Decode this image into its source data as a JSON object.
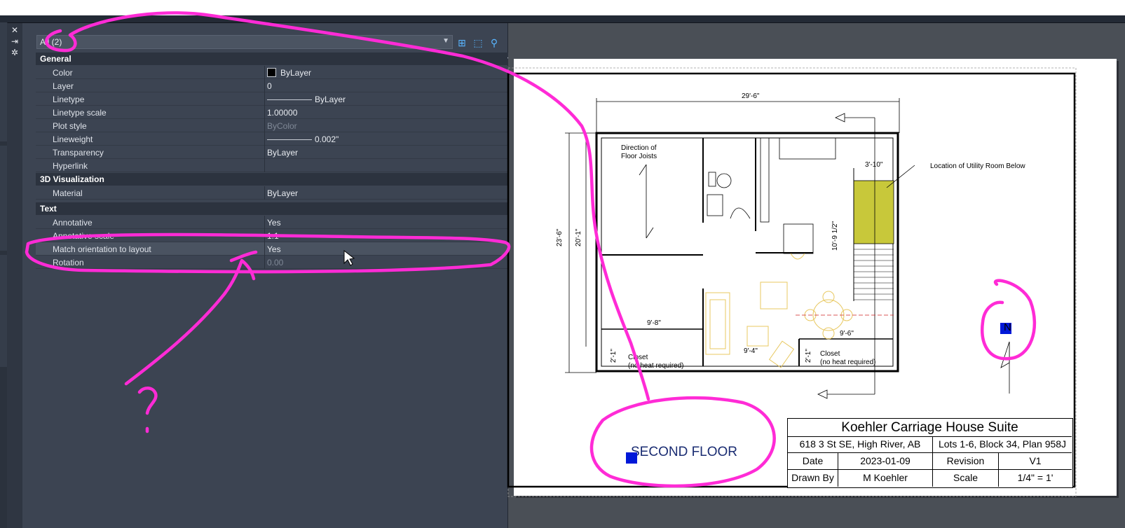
{
  "selection": {
    "label": "All (2)"
  },
  "sections": {
    "general": "General",
    "viz3d": "3D Visualization",
    "text": "Text"
  },
  "general": [
    {
      "key": "Color",
      "value": "ByLayer"
    },
    {
      "key": "Layer",
      "value": "0"
    },
    {
      "key": "Linetype",
      "value": "ByLayer"
    },
    {
      "key": "Linetype scale",
      "value": "1.00000"
    },
    {
      "key": "Plot style",
      "value": "ByColor"
    },
    {
      "key": "Lineweight",
      "value": "0.002\""
    },
    {
      "key": "Transparency",
      "value": "ByLayer"
    },
    {
      "key": "Hyperlink",
      "value": ""
    }
  ],
  "viz3d": [
    {
      "key": "Material",
      "value": "ByLayer"
    }
  ],
  "text": [
    {
      "key": "Annotative",
      "value": "Yes"
    },
    {
      "key": "Annotative scale",
      "value": "1:1"
    },
    {
      "key": "Match orientation to layout",
      "value": "Yes"
    },
    {
      "key": "Rotation",
      "value": "0.00"
    }
  ],
  "drawing": {
    "dim_top": "29'-6\"",
    "dim_left_outer": "23'-6\"",
    "dim_left_inner": "20'-1\"",
    "dim_stair_width": "3'-10\"",
    "dim_stair_len": "10'-9 1/2\"",
    "dim_bottom_left": "9'-8\"",
    "dim_bottom_mid": "9'-4\"",
    "dim_bottom_right": "9'-6\"",
    "dim_closet": "2'-1\"",
    "joists": "Direction of\nFloor Joists",
    "utility_note": "Location of Utility Room Below",
    "closet_left": "Closet\n(no heat required)",
    "closet_right": "Closet\n(no heat required)",
    "floor_label": "SECOND FLOOR",
    "north": "N"
  },
  "titleblock": {
    "title": "Koehler Carriage House Suite",
    "address": "618 3 St SE, High River, AB",
    "lots": "Lots 1-6, Block 34, Plan 958J",
    "date_label": "Date",
    "date_value": "2023-01-09",
    "revision_label": "Revision",
    "revision_value": "V1",
    "drawn_label": "Drawn By",
    "drawn_value": "M Koehler",
    "scale_label": "Scale",
    "scale_value": "1/4\" = 1'"
  },
  "colors": {
    "annotation": "#ff2bd6",
    "accent_blue": "#0018d8",
    "utility_room": "#c8c83a",
    "furniture": "#e8c860"
  },
  "icons": [
    "close-icon",
    "pin-icon",
    "settings-icon",
    "quick-select-icon",
    "select-objects-icon",
    "toggle-pickadd-icon"
  ]
}
